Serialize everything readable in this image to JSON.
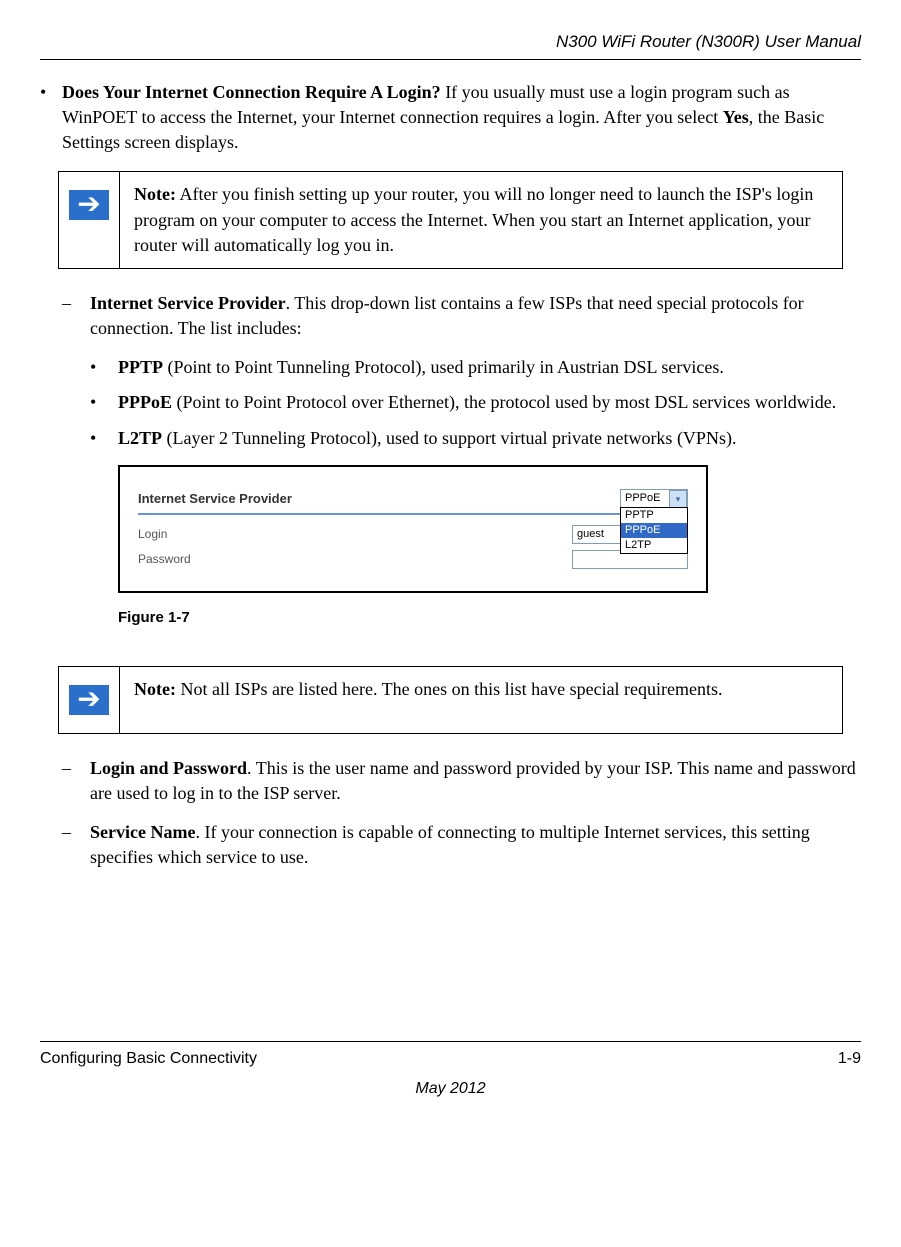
{
  "header": {
    "title": "N300 WiFi Router (N300R) User Manual"
  },
  "mainBullet": {
    "marker": "•",
    "boldLead": "Does Your Internet Connection Require A Login?",
    "text": " If you usually must use a login program such as WinPOET to access the Internet, your Internet connection requires a login. After you select ",
    "boldYes": "Yes",
    "textAfter": ", the Basic Settings screen displays."
  },
  "note1": {
    "label": "Note:",
    "text": " After you finish setting up your router, you will no longer need to launch the ISP's login program on your computer to access the Internet. When you start an Internet application, your router will automatically log you in."
  },
  "ispItem": {
    "dash": "–",
    "bold": "Internet Service Provider",
    "text": ". This drop-down list contains a few ISPs that need special protocols for connection. The list includes:"
  },
  "protocols": {
    "pptp": {
      "marker": "•",
      "bold": "PPTP",
      "text": " (Point to Point Tunneling Protocol), used primarily in Austrian DSL services."
    },
    "pppoe": {
      "marker": "•",
      "bold": "PPPoE",
      "text": " (Point to Point Protocol over Ethernet), the protocol used by most DSL services worldwide."
    },
    "l2tp": {
      "marker": "•",
      "bold": "L2TP",
      "text": " (Layer 2 Tunneling Protocol), used to support virtual private networks (VPNs)."
    }
  },
  "figurePanel": {
    "ispLabel": "Internet Service Provider",
    "loginLabel": "Login",
    "passwordLabel": "Password",
    "selectedValue": "PPPoE",
    "options": [
      "PPTP",
      "PPPoE",
      "L2TP"
    ],
    "loginValue": "guest",
    "passwordValue": ""
  },
  "figureCaption": "Figure 1-7",
  "note2": {
    "label": "Note:",
    "text": " Not all ISPs are listed here. The ones on this list have special requirements."
  },
  "loginItem": {
    "dash": "–",
    "bold": "Login and Password",
    "text": ". This is the user name and password provided by your ISP. This name and password are used to log in to the ISP server."
  },
  "serviceItem": {
    "dash": "–",
    "bold": "Service Name",
    "text": ". If your connection is capable of connecting to multiple Internet services, this setting specifies which service to use."
  },
  "footer": {
    "section": "Configuring Basic Connectivity",
    "page": "1-9",
    "date": "May 2012"
  }
}
